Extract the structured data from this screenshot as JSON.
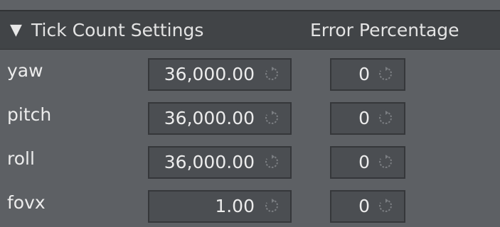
{
  "header": {
    "collapse_icon": "triangle-down",
    "title": "Tick Count Settings",
    "column_title": "Error Percentage"
  },
  "rows": [
    {
      "label": "yaw",
      "value": "36,000.00",
      "error": "0"
    },
    {
      "label": "pitch",
      "value": "36,000.00",
      "error": "0"
    },
    {
      "label": "roll",
      "value": "36,000.00",
      "error": "0"
    },
    {
      "label": "fovx",
      "value": "1.00",
      "error": "0"
    }
  ],
  "colors": {
    "panel_bg": "#5d6064",
    "header_bg": "#414447",
    "field_bg": "#4b4e52",
    "text": "#ececec"
  }
}
